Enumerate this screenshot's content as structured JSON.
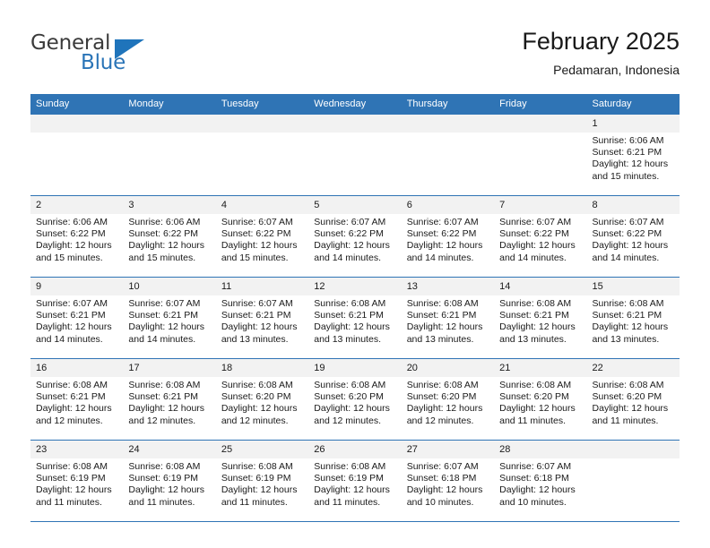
{
  "brand": {
    "name_part1": "General",
    "name_part2": "Blue",
    "accent_color": "#2a74b7",
    "triangle_icon": "triangle-icon"
  },
  "header": {
    "title": "February 2025",
    "subtitle": "Pedamaran, Indonesia"
  },
  "calendar": {
    "header_bg": "#2f74b5",
    "daynum_bg": "#f2f2f2",
    "weekdays": [
      "Sunday",
      "Monday",
      "Tuesday",
      "Wednesday",
      "Thursday",
      "Friday",
      "Saturday"
    ],
    "weeks": [
      [
        {
          "day": "",
          "sunrise": "",
          "sunset": "",
          "daylight_line1": "",
          "daylight_line2": ""
        },
        {
          "day": "",
          "sunrise": "",
          "sunset": "",
          "daylight_line1": "",
          "daylight_line2": ""
        },
        {
          "day": "",
          "sunrise": "",
          "sunset": "",
          "daylight_line1": "",
          "daylight_line2": ""
        },
        {
          "day": "",
          "sunrise": "",
          "sunset": "",
          "daylight_line1": "",
          "daylight_line2": ""
        },
        {
          "day": "",
          "sunrise": "",
          "sunset": "",
          "daylight_line1": "",
          "daylight_line2": ""
        },
        {
          "day": "",
          "sunrise": "",
          "sunset": "",
          "daylight_line1": "",
          "daylight_line2": ""
        },
        {
          "day": "1",
          "sunrise": "Sunrise: 6:06 AM",
          "sunset": "Sunset: 6:21 PM",
          "daylight_line1": "Daylight: 12 hours",
          "daylight_line2": "and 15 minutes."
        }
      ],
      [
        {
          "day": "2",
          "sunrise": "Sunrise: 6:06 AM",
          "sunset": "Sunset: 6:22 PM",
          "daylight_line1": "Daylight: 12 hours",
          "daylight_line2": "and 15 minutes."
        },
        {
          "day": "3",
          "sunrise": "Sunrise: 6:06 AM",
          "sunset": "Sunset: 6:22 PM",
          "daylight_line1": "Daylight: 12 hours",
          "daylight_line2": "and 15 minutes."
        },
        {
          "day": "4",
          "sunrise": "Sunrise: 6:07 AM",
          "sunset": "Sunset: 6:22 PM",
          "daylight_line1": "Daylight: 12 hours",
          "daylight_line2": "and 15 minutes."
        },
        {
          "day": "5",
          "sunrise": "Sunrise: 6:07 AM",
          "sunset": "Sunset: 6:22 PM",
          "daylight_line1": "Daylight: 12 hours",
          "daylight_line2": "and 14 minutes."
        },
        {
          "day": "6",
          "sunrise": "Sunrise: 6:07 AM",
          "sunset": "Sunset: 6:22 PM",
          "daylight_line1": "Daylight: 12 hours",
          "daylight_line2": "and 14 minutes."
        },
        {
          "day": "7",
          "sunrise": "Sunrise: 6:07 AM",
          "sunset": "Sunset: 6:22 PM",
          "daylight_line1": "Daylight: 12 hours",
          "daylight_line2": "and 14 minutes."
        },
        {
          "day": "8",
          "sunrise": "Sunrise: 6:07 AM",
          "sunset": "Sunset: 6:22 PM",
          "daylight_line1": "Daylight: 12 hours",
          "daylight_line2": "and 14 minutes."
        }
      ],
      [
        {
          "day": "9",
          "sunrise": "Sunrise: 6:07 AM",
          "sunset": "Sunset: 6:21 PM",
          "daylight_line1": "Daylight: 12 hours",
          "daylight_line2": "and 14 minutes."
        },
        {
          "day": "10",
          "sunrise": "Sunrise: 6:07 AM",
          "sunset": "Sunset: 6:21 PM",
          "daylight_line1": "Daylight: 12 hours",
          "daylight_line2": "and 14 minutes."
        },
        {
          "day": "11",
          "sunrise": "Sunrise: 6:07 AM",
          "sunset": "Sunset: 6:21 PM",
          "daylight_line1": "Daylight: 12 hours",
          "daylight_line2": "and 13 minutes."
        },
        {
          "day": "12",
          "sunrise": "Sunrise: 6:08 AM",
          "sunset": "Sunset: 6:21 PM",
          "daylight_line1": "Daylight: 12 hours",
          "daylight_line2": "and 13 minutes."
        },
        {
          "day": "13",
          "sunrise": "Sunrise: 6:08 AM",
          "sunset": "Sunset: 6:21 PM",
          "daylight_line1": "Daylight: 12 hours",
          "daylight_line2": "and 13 minutes."
        },
        {
          "day": "14",
          "sunrise": "Sunrise: 6:08 AM",
          "sunset": "Sunset: 6:21 PM",
          "daylight_line1": "Daylight: 12 hours",
          "daylight_line2": "and 13 minutes."
        },
        {
          "day": "15",
          "sunrise": "Sunrise: 6:08 AM",
          "sunset": "Sunset: 6:21 PM",
          "daylight_line1": "Daylight: 12 hours",
          "daylight_line2": "and 13 minutes."
        }
      ],
      [
        {
          "day": "16",
          "sunrise": "Sunrise: 6:08 AM",
          "sunset": "Sunset: 6:21 PM",
          "daylight_line1": "Daylight: 12 hours",
          "daylight_line2": "and 12 minutes."
        },
        {
          "day": "17",
          "sunrise": "Sunrise: 6:08 AM",
          "sunset": "Sunset: 6:21 PM",
          "daylight_line1": "Daylight: 12 hours",
          "daylight_line2": "and 12 minutes."
        },
        {
          "day": "18",
          "sunrise": "Sunrise: 6:08 AM",
          "sunset": "Sunset: 6:20 PM",
          "daylight_line1": "Daylight: 12 hours",
          "daylight_line2": "and 12 minutes."
        },
        {
          "day": "19",
          "sunrise": "Sunrise: 6:08 AM",
          "sunset": "Sunset: 6:20 PM",
          "daylight_line1": "Daylight: 12 hours",
          "daylight_line2": "and 12 minutes."
        },
        {
          "day": "20",
          "sunrise": "Sunrise: 6:08 AM",
          "sunset": "Sunset: 6:20 PM",
          "daylight_line1": "Daylight: 12 hours",
          "daylight_line2": "and 12 minutes."
        },
        {
          "day": "21",
          "sunrise": "Sunrise: 6:08 AM",
          "sunset": "Sunset: 6:20 PM",
          "daylight_line1": "Daylight: 12 hours",
          "daylight_line2": "and 11 minutes."
        },
        {
          "day": "22",
          "sunrise": "Sunrise: 6:08 AM",
          "sunset": "Sunset: 6:20 PM",
          "daylight_line1": "Daylight: 12 hours",
          "daylight_line2": "and 11 minutes."
        }
      ],
      [
        {
          "day": "23",
          "sunrise": "Sunrise: 6:08 AM",
          "sunset": "Sunset: 6:19 PM",
          "daylight_line1": "Daylight: 12 hours",
          "daylight_line2": "and 11 minutes."
        },
        {
          "day": "24",
          "sunrise": "Sunrise: 6:08 AM",
          "sunset": "Sunset: 6:19 PM",
          "daylight_line1": "Daylight: 12 hours",
          "daylight_line2": "and 11 minutes."
        },
        {
          "day": "25",
          "sunrise": "Sunrise: 6:08 AM",
          "sunset": "Sunset: 6:19 PM",
          "daylight_line1": "Daylight: 12 hours",
          "daylight_line2": "and 11 minutes."
        },
        {
          "day": "26",
          "sunrise": "Sunrise: 6:08 AM",
          "sunset": "Sunset: 6:19 PM",
          "daylight_line1": "Daylight: 12 hours",
          "daylight_line2": "and 11 minutes."
        },
        {
          "day": "27",
          "sunrise": "Sunrise: 6:07 AM",
          "sunset": "Sunset: 6:18 PM",
          "daylight_line1": "Daylight: 12 hours",
          "daylight_line2": "and 10 minutes."
        },
        {
          "day": "28",
          "sunrise": "Sunrise: 6:07 AM",
          "sunset": "Sunset: 6:18 PM",
          "daylight_line1": "Daylight: 12 hours",
          "daylight_line2": "and 10 minutes."
        },
        {
          "day": "",
          "sunrise": "",
          "sunset": "",
          "daylight_line1": "",
          "daylight_line2": ""
        }
      ]
    ]
  }
}
